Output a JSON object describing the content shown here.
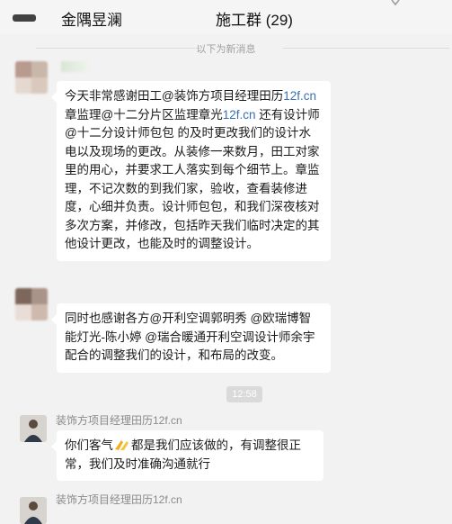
{
  "header": {
    "title_prefix": "金隅昱澜",
    "title_suffix": "施工群 (29)"
  },
  "divider": {
    "new_messages_label": "以下为新消息"
  },
  "messages": [
    {
      "text_parts": [
        "今天非常感谢田工@装饰方项目经理田历",
        "12f.cn",
        " 章监理@十二分片区监理章光",
        "12f.cn",
        " 还有设计师@十二分设计师包包 的及时更改我们的设计水电以及现场的更改。从装修一来数月，田工对家里的用心，并要求工人落实到每个细节上。章监理，不记次数的到我们家，验收，查看装修进度，心细并负责。设计师包包，和我们深夜核对多次方案，并修改，包括昨天我们临时决定的其他设计更改，也能及时的调整设计。"
      ]
    },
    {
      "text": "同时也感谢各方@开利空调郭明秀 @欧瑞博智能灯光-陈小婷 @瑞合暖通开利空调设计师余宇 配合的调整我们的设计，和布局的改变。"
    }
  ],
  "time_divider": "12:58",
  "reply": {
    "sender": "装饰方项目经理田历12f.cn",
    "text_before": "你们客气",
    "emoji": "clap-emoji",
    "text_after": "都是我们应该做的，有调整很正常，我们及时准确沟通就行"
  },
  "next_sender": "装饰方项目经理田历12f.cn"
}
